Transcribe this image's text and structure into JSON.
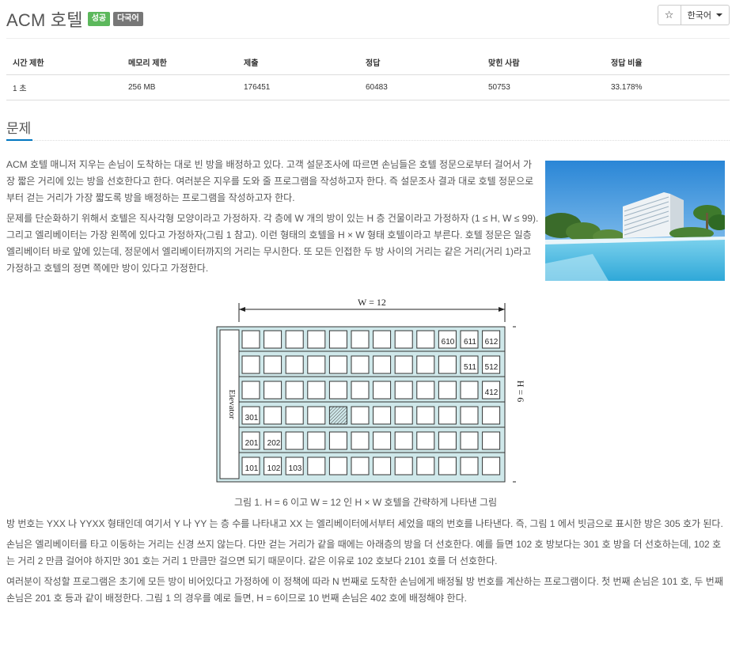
{
  "problem": {
    "title": "ACM 호텔",
    "badges": [
      "성공",
      "다국어"
    ],
    "language": "한국어",
    "star_icon": "star-icon"
  },
  "info_table": {
    "headers": [
      "시간 제한",
      "메모리 제한",
      "제출",
      "정답",
      "맞힌 사람",
      "정답 비율"
    ],
    "values": [
      "1 초",
      "256 MB",
      "176451",
      "60483",
      "50753",
      "33.178%"
    ]
  },
  "section": {
    "title": "문제"
  },
  "paragraphs": {
    "p1": "ACM 호텔 매니저 지우는 손님이 도착하는 대로 빈 방을 배정하고 있다. 고객 설문조사에 따르면 손님들은 호텔 정문으로부터 걸어서 가장 짧은 거리에 있는 방을 선호한다고 한다. 여러분은 지우를 도와 줄 프로그램을 작성하고자 한다. 즉 설문조사 결과 대로 호텔 정문으로부터 걷는 거리가 가장 짧도록 방을 배정하는 프로그램을 작성하고자 한다.",
    "p2": "문제를 단순화하기 위해서 호텔은 직사각형 모양이라고 가정하자. 각 층에 W 개의 방이 있는 H 층 건물이라고 가정하자 (1 ≤ H, W ≤ 99). 그리고 엘리베이터는 가장 왼쪽에 있다고 가정하자(그림 1 참고). 이런 형태의 호텔을 H × W 형태 호텔이라고 부른다. 호텔 정문은 일층 엘리베이터 바로 앞에 있는데, 정문에서 엘리베이터까지의 거리는 무시한다. 또 모든 인접한 두 방 사이의 거리는 같은 거리(거리 1)라고 가정하고 호텔의 정면 쪽에만 방이 있다고 가정한다.",
    "caption": "그림 1. H = 6 이고 W = 12 인 H × W 호텔을 간략하게 나타낸 그림",
    "p3": "방 번호는 YXX 나 YYXX 형태인데 여기서 Y 나 YY 는 층 수를 나타내고 XX 는 엘리베이터에서부터 세었을 때의 번호를 나타낸다. 즉, 그림 1 에서 빗금으로 표시한 방은 305 호가 된다.",
    "p4": "손님은 엘리베이터를 타고 이동하는 거리는 신경 쓰지 않는다. 다만 걷는 거리가 같을 때에는 아래층의 방을 더 선호한다. 예를 들면 102 호 방보다는 301 호 방을 더 선호하는데, 102 호는 거리 2 만큼 걸어야 하지만 301 호는 거리 1 만큼만 걸으면 되기 때문이다. 같은 이유로 102 호보다 2101 호를 더 선호한다.",
    "p5": "여러분이 작성할 프로그램은 초기에 모든 방이 비어있다고 가정하에 이 정책에 따라 N 번째로 도착한 손님에게 배정될 방 번호를 계산하는 프로그램이다. 첫 번째 손님은 101 호, 두 번째 손님은 201 호 등과 같이 배정한다. 그림 1 의 경우를 예로 들면, H = 6이므로 10 번째 손님은 402 호에 배정해야 한다."
  },
  "figure": {
    "width_label": "W = 12",
    "height_label": "H = 6",
    "elevator_label": "Elevator",
    "rooms": {
      "r610": "610",
      "r611": "611",
      "r612": "612",
      "r511": "511",
      "r512": "512",
      "r412": "412",
      "r301": "301",
      "r201": "201",
      "r202": "202",
      "r101": "101",
      "r102": "102",
      "r103": "103"
    }
  }
}
